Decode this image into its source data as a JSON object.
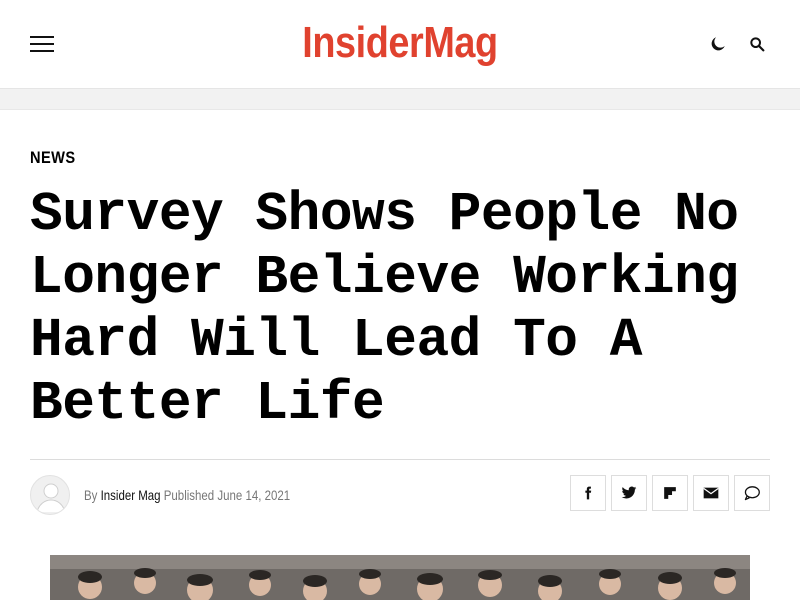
{
  "site": {
    "logo": "InsiderMag"
  },
  "header": {
    "icons": {
      "menu": "hamburger-menu-icon",
      "theme": "moon-icon",
      "search": "search-icon"
    }
  },
  "article": {
    "category": "NEWS",
    "title": "Survey Shows People No Longer Believe Working Hard Will Lead To A Better Life",
    "meta": {
      "by_label": "By",
      "author": "Insider Mag",
      "published_label": "Published",
      "date": "June 14, 2021"
    },
    "share_icons": [
      "facebook-icon",
      "twitter-icon",
      "flipboard-icon",
      "email-icon",
      "comment-icon"
    ]
  },
  "colors": {
    "brand": "#e0422f",
    "text": "#000000",
    "muted": "#777777"
  }
}
